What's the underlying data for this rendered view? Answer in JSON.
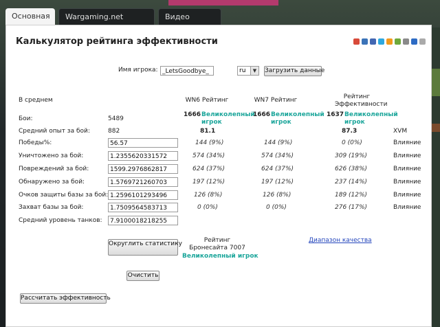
{
  "tabs": [
    {
      "label": "Основная"
    },
    {
      "label": "Wargaming.net League"
    },
    {
      "label": "Видео раздел"
    }
  ],
  "page_title": "Калькулятор рейтинга эффективности",
  "player": {
    "label": "Имя игрока:",
    "value": "_LetsGoodbye_",
    "region": "ru",
    "load_button": "Загрузить данные"
  },
  "columns": {
    "avg": "В среднем",
    "wn6": "WN6 Рейтинг",
    "wn7": "WN7 Рейтинг",
    "eff": "Рейтинг Эффективности"
  },
  "summary": {
    "battles_label": "Бои:",
    "battles_value": "5489",
    "wn6_score": "1666",
    "wn6_rank": "Великолепный игрок",
    "wn7_score": "1666",
    "wn7_rank": "Великолепный игрок",
    "eff_score": "1637",
    "eff_rank": "Великолепный игрок",
    "avgxp_label": "Средний опыт за бой:",
    "avgxp_value": "882",
    "wn6_value": "81.1",
    "eff_value": "87.3",
    "xvm": "XVM"
  },
  "rows": [
    {
      "label": "Победы%:",
      "value": "56.57",
      "wn6": "144 (9%)",
      "wn7": "144 (9%)",
      "eff": "0 (0%)",
      "tag": "Влияние"
    },
    {
      "label": "Уничтожено за бой:",
      "value": "1.2355620331572",
      "wn6": "574 (34%)",
      "wn7": "574 (34%)",
      "eff": "309 (19%)",
      "tag": "Влияние"
    },
    {
      "label": "Повреждений за бой:",
      "value": "1599.2976862817",
      "wn6": "624 (37%)",
      "wn7": "624 (37%)",
      "eff": "626 (38%)",
      "tag": "Влияние"
    },
    {
      "label": "Обнаружено за бой:",
      "value": "1.5769721260703",
      "wn6": "197 (12%)",
      "wn7": "197 (12%)",
      "eff": "237 (14%)",
      "tag": "Влияние"
    },
    {
      "label": "Очков защиты базы за бой:",
      "value": "1.2596101293496",
      "wn6": "126 (8%)",
      "wn7": "126 (8%)",
      "eff": "189 (12%)",
      "tag": "Влияние"
    },
    {
      "label": "Захват базы за бой:",
      "value": "1.7509564583713",
      "wn6": "0 (0%)",
      "wn7": "0 (0%)",
      "eff": "276 (17%)",
      "tag": "Влияние"
    },
    {
      "label": "Средний уровень танков:",
      "value": "7.9100018218255"
    }
  ],
  "bottom": {
    "round_button": "Округлить статистику",
    "armor_title": "Рейтинг Бронесайта 7007",
    "armor_rank": "Великолепный игрок",
    "quality_link": "Диапазон качества",
    "clear_button": "Очистить",
    "calc_button": "Рассчитать эффективность"
  },
  "colors": {
    "rank_teal": "#1aa59a",
    "link_blue": "#2244bb"
  }
}
